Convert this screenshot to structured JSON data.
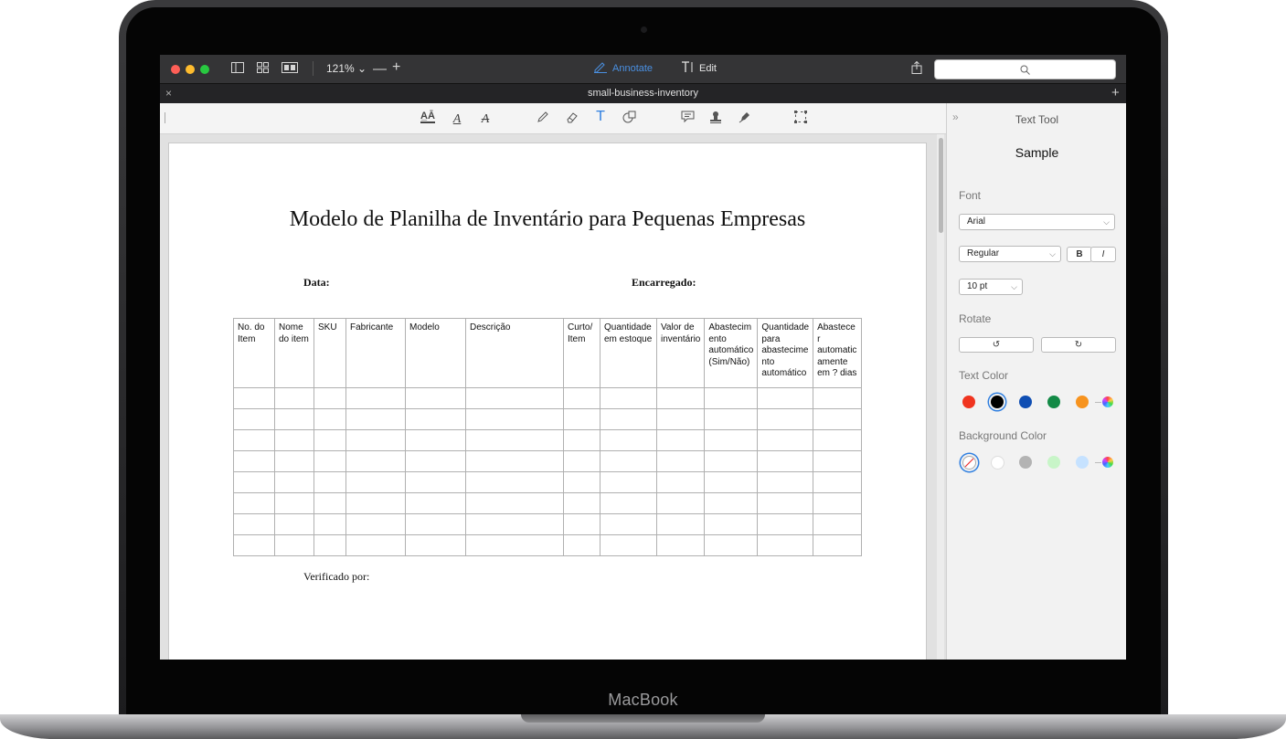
{
  "device": {
    "brand": "MacBook"
  },
  "toolbar": {
    "zoom": "121%",
    "zoom_out": "—",
    "zoom_in": "+",
    "annotate_label": "Annotate",
    "edit_label": "Edit"
  },
  "tab": {
    "title": "small-business-inventory",
    "close": "×",
    "add": "+"
  },
  "document": {
    "title": "Modelo de Planilha de Inventário para Pequenas Empresas",
    "date_label": "Data:",
    "manager_label": "Encarregado:",
    "verified_label": "Verificado por:",
    "columns": [
      "No. do Item",
      "Nome do item",
      "SKU",
      "Fabricante",
      "Modelo",
      "Descrição",
      "Curto/ Item",
      "Quantidade em estoque",
      "Valor de inventário",
      "Abastecim ento automático (Sim/Não)",
      "Quantidade para abastecime nto automático",
      "Abastece r automatic amente em ? dias"
    ],
    "empty_rows": 8
  },
  "panel": {
    "title": "Text Tool",
    "collapse": "»",
    "sample": "Sample",
    "font_label": "Font",
    "font_value": "Arial",
    "style_value": "Regular",
    "bold": "B",
    "italic": "I",
    "size_value": "10 pt",
    "rotate_label": "Rotate",
    "text_color_label": "Text Color",
    "background_color_label": "Background Color",
    "text_colors": [
      "#f0341f",
      "#000000",
      "#0f4eb3",
      "#138a46",
      "#f7931e"
    ],
    "selected_text_color": "#000000",
    "background_colors": [
      "none",
      "#ffffff",
      "#b3b3b3",
      "#c8f5c8",
      "#c6e2ff"
    ],
    "selected_background_color": "none"
  }
}
